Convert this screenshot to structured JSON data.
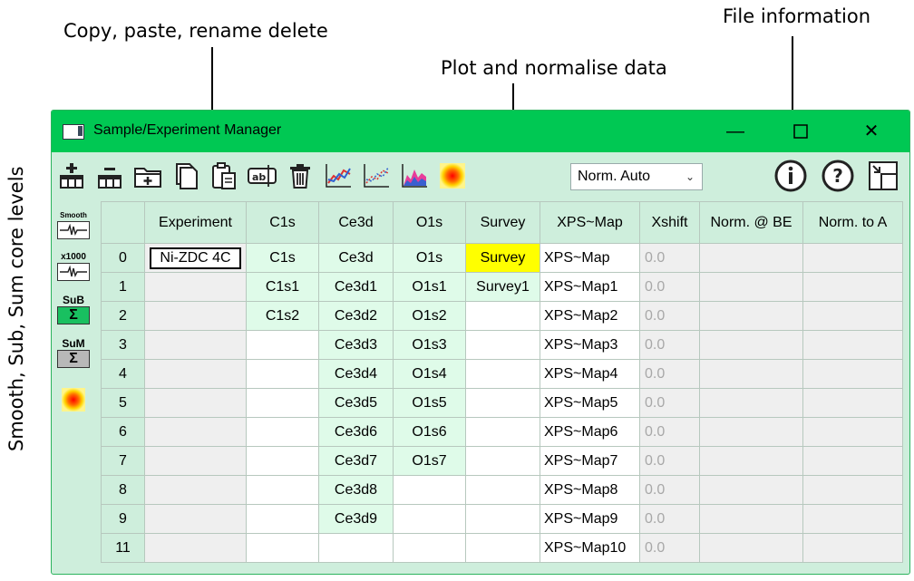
{
  "annotations": {
    "copy": "Copy, paste, rename delete",
    "plot": "Plot and normalise data",
    "file": "File information",
    "side": "Smooth, Sub, Sum core levels"
  },
  "window": {
    "title": "Sample/Experiment Manager",
    "minimize": "—",
    "close": "✕"
  },
  "toolbar": {
    "norm_select": "Norm. Auto",
    "info": "i",
    "help": "?"
  },
  "sidebar": {
    "smooth": "Smooth",
    "x1000": "x1000",
    "sub": "SuB",
    "sum": "SuM",
    "sigma": "Σ"
  },
  "table": {
    "headers": [
      "Experiment",
      "C1s",
      "Ce3d",
      "O1s",
      "Survey",
      "XPS~Map",
      "Xshift",
      "Norm. @ BE",
      "Norm. to A"
    ],
    "row_labels": [
      "0",
      "1",
      "2",
      "3",
      "4",
      "5",
      "6",
      "7",
      "8",
      "9",
      "11"
    ],
    "experiment": "Ni-ZDC 4C",
    "c1s": [
      "C1s",
      "C1s1",
      "C1s2"
    ],
    "ce3d": [
      "Ce3d",
      "Ce3d1",
      "Ce3d2",
      "Ce3d3",
      "Ce3d4",
      "Ce3d5",
      "Ce3d6",
      "Ce3d7",
      "Ce3d8",
      "Ce3d9"
    ],
    "o1s": [
      "O1s",
      "O1s1",
      "O1s2",
      "O1s3",
      "O1s4",
      "O1s5",
      "O1s6",
      "O1s7"
    ],
    "survey": [
      "Survey",
      "Survey1"
    ],
    "xpsmap": [
      "XPS~Map",
      "XPS~Map1",
      "XPS~Map2",
      "XPS~Map3",
      "XPS~Map4",
      "XPS~Map5",
      "XPS~Map6",
      "XPS~Map7",
      "XPS~Map8",
      "XPS~Map9",
      "XPS~Map10"
    ],
    "xshift": "0.0"
  },
  "colors": {
    "titlebar": "#00c853",
    "panel": "#ceeedc",
    "cell_green": "#dffbe9",
    "selected": "#ffff00"
  }
}
